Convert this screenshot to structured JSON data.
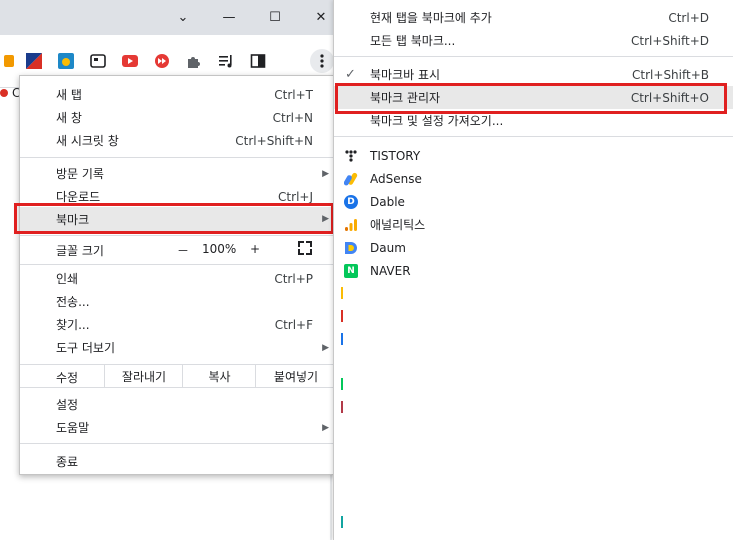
{
  "window": {
    "minimize_label": "—",
    "maximize_label": "☐",
    "close_label": "✕",
    "tab_dropdown_label": "⌄"
  },
  "toolbar": {
    "icons": [
      "rss-icon",
      "flag-icon",
      "weather-icon",
      "screenshot-icon",
      "youtube-icon",
      "media-icon",
      "extensions-icon",
      "playlist-icon",
      "sidepanel-icon",
      "menu-kebab-icon"
    ],
    "bookmark_bar_partial": "C"
  },
  "menu": {
    "items_group1": [
      {
        "label": "새 탭",
        "shortcut": "Ctrl+T"
      },
      {
        "label": "새 창",
        "shortcut": "Ctrl+N"
      },
      {
        "label": "새 시크릿 창",
        "shortcut": "Ctrl+Shift+N"
      }
    ],
    "items_group2": [
      {
        "label": "방문 기록",
        "shortcut": ""
      },
      {
        "label": "다운로드",
        "shortcut": "Ctrl+J"
      },
      {
        "label": "북마크",
        "shortcut": ""
      }
    ],
    "zoom": {
      "label": "글꼴 크기",
      "minus": "－",
      "value": "100%",
      "plus": "+"
    },
    "items_group3": [
      {
        "label": "인쇄",
        "shortcut": "Ctrl+P"
      },
      {
        "label": "전송...",
        "shortcut": ""
      },
      {
        "label": "찾기...",
        "shortcut": "Ctrl+F"
      },
      {
        "label": "도구 더보기",
        "shortcut": ""
      }
    ],
    "edit": {
      "label": "수정",
      "cut": "잘라내기",
      "copy": "복사",
      "paste": "붙여넣기"
    },
    "items_group4": [
      {
        "label": "설정",
        "shortcut": ""
      },
      {
        "label": "도움말",
        "shortcut": ""
      }
    ],
    "exit": {
      "label": "종료"
    }
  },
  "submenu": {
    "top": [
      {
        "label": "현재 탭을 북마크에 추가",
        "shortcut": "Ctrl+D"
      },
      {
        "label": "모든 탭 북마크...",
        "shortcut": "Ctrl+Shift+D"
      }
    ],
    "mid": [
      {
        "label": "북마크바 표시",
        "shortcut": "Ctrl+Shift+B",
        "checked": true
      },
      {
        "label": "북마크 관리자",
        "shortcut": "Ctrl+Shift+O"
      },
      {
        "label": "북마크 및 설정 가져오기...",
        "shortcut": ""
      }
    ],
    "bookmarks": [
      {
        "label": "TISTORY",
        "color": "#202124"
      },
      {
        "label": "AdSense",
        "color": "#fbbc04"
      },
      {
        "label": "Dable",
        "color": "#1a73e8"
      },
      {
        "label": "애널리틱스",
        "color": "#f9ab00"
      },
      {
        "label": "Daum",
        "color": "#4285f4"
      },
      {
        "label": "NAVER",
        "color": "#03c75a"
      }
    ]
  },
  "highlight_color": "#e02020"
}
